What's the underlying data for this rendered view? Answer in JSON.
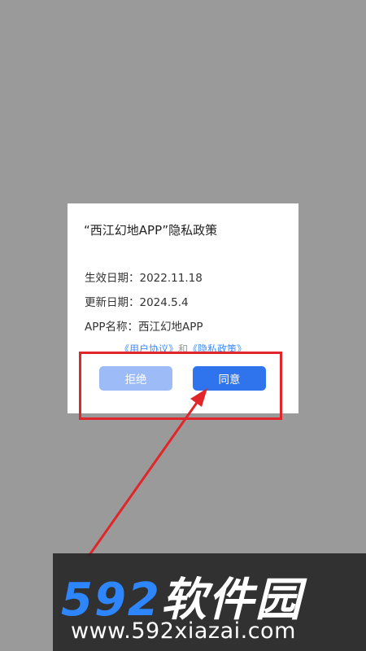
{
  "dialog": {
    "title": "“西江幻地APP”隐私政策",
    "effective_date": "生效日期：2022.11.18",
    "update_date": "更新日期：2024.5.4",
    "app_name": "APP名称：西江幻地APP",
    "user_agreement_link": "《用户协议》",
    "and_text": "和",
    "privacy_policy_link": "《隐私政策》",
    "refuse_label": "拒绝",
    "agree_label": "同意"
  },
  "watermark": {
    "logo_number": "592",
    "logo_text": "软件园",
    "url": "www.592xiazai.com"
  },
  "colors": {
    "agree_button": "#2f74ec",
    "refuse_button": "#9dbcf7",
    "annotation": "#e0262a",
    "link": "#3d8bfd"
  }
}
